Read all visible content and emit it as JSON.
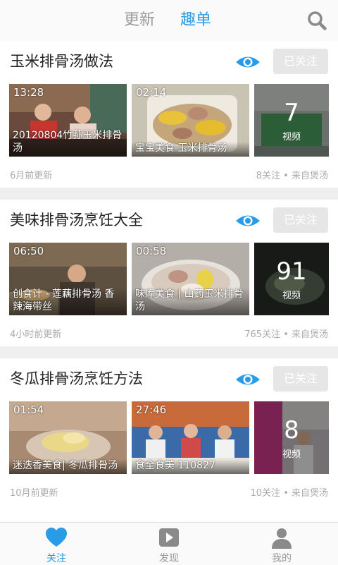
{
  "header": {
    "tabs": [
      {
        "label": "更新",
        "active": false
      },
      {
        "label": "趣单",
        "active": true
      }
    ],
    "search_icon": "search-icon"
  },
  "colors": {
    "accent": "#2a9be6",
    "muted": "#aaaaaa",
    "follow_button_bg": "#e6e6e6"
  },
  "cards": [
    {
      "title": "玉米排骨汤做法",
      "follow_label": "已关注",
      "videos": [
        {
          "duration": "13:28",
          "caption": "20120804竹荪玉米排骨汤"
        },
        {
          "duration": "02:14",
          "caption": "宝宝美食 玉米排骨汤"
        }
      ],
      "more": {
        "count": "7",
        "label": "视频"
      },
      "updated": "6月前更新",
      "stats": "8关注 • 来自煲汤"
    },
    {
      "title": "美味排骨汤烹饪大全",
      "follow_label": "已关注",
      "videos": [
        {
          "duration": "06:50",
          "caption": "创食计 - 莲藕排骨汤 香辣海带丝"
        },
        {
          "duration": "00:58",
          "caption": "味库美食 | 山药玉米排骨汤"
        }
      ],
      "more": {
        "count": "91",
        "label": "视频"
      },
      "updated": "4小时前更新",
      "stats": "765关注 • 来自煲汤"
    },
    {
      "title": "冬瓜排骨汤烹饪方法",
      "follow_label": "已关注",
      "videos": [
        {
          "duration": "01:54",
          "caption": "迷迭香美食| 冬瓜排骨汤"
        },
        {
          "duration": "27:46",
          "caption": "食全食美 110827"
        }
      ],
      "more": {
        "count": "8",
        "label": "视频"
      },
      "updated": "10月前更新",
      "stats": "10关注 • 来自煲汤"
    }
  ],
  "bottom_nav": [
    {
      "label": "关注",
      "icon": "heart-icon",
      "active": true
    },
    {
      "label": "发现",
      "icon": "play-icon",
      "active": false
    },
    {
      "label": "我的",
      "icon": "person-icon",
      "active": false
    }
  ]
}
